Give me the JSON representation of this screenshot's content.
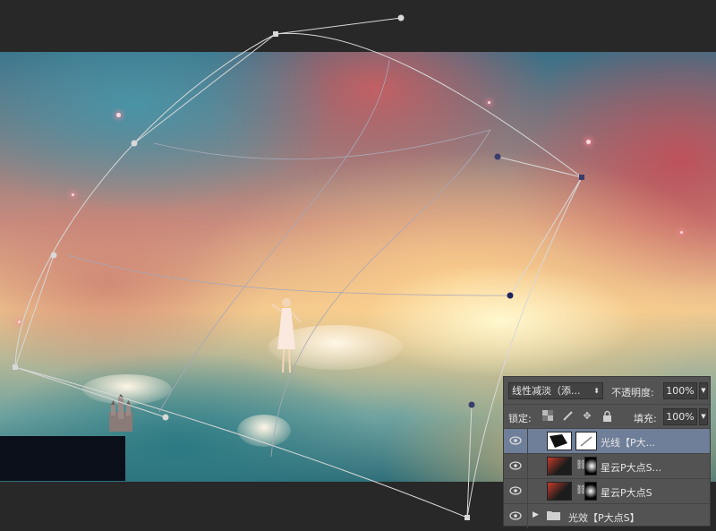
{
  "layers_panel": {
    "blend_mode": "线性减淡（添...",
    "opacity_label": "不透明度:",
    "opacity_value": "100%",
    "lock_label": "锁定:",
    "fill_label": "填充:",
    "fill_value": "100%",
    "layers": [
      {
        "name": "光线【P大...",
        "selected": true,
        "type": "layer-with-mask"
      },
      {
        "name": "星云P大点S...",
        "selected": false,
        "type": "layer-with-mask"
      },
      {
        "name": "星云P大点S",
        "selected": false,
        "type": "layer-with-mask"
      },
      {
        "name": "光效【P大点S】",
        "selected": false,
        "type": "group"
      }
    ]
  },
  "icons": {
    "eye": "eye-icon",
    "chain": "chain-link-icon",
    "folder": "folder-icon",
    "lock_pixels": "checkerboard-lock-icon",
    "lock_brush": "brush-lock-icon",
    "lock_move": "move-lock-icon",
    "lock_all": "padlock-icon"
  },
  "colors": {
    "panel_bg": "#535353",
    "selected_row": "#6f7f99",
    "workspace_bg": "#282828",
    "warp_line": "#d8d8d8"
  }
}
